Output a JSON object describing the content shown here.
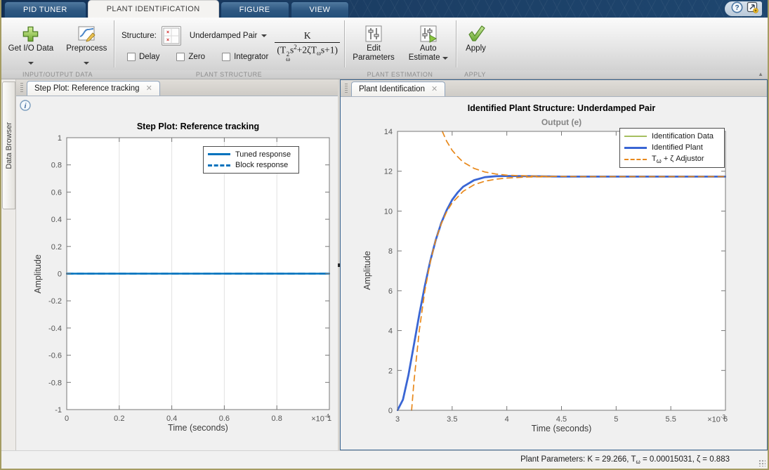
{
  "tabs": [
    {
      "label": "PID TUNER",
      "active": false
    },
    {
      "label": "PLANT IDENTIFICATION",
      "active": true
    },
    {
      "label": "FIGURE",
      "active": false
    },
    {
      "label": "VIEW",
      "active": false
    }
  ],
  "ribbon": {
    "get_io_data": "Get I/O Data",
    "preprocess": "Preprocess",
    "structure_label": "Structure:",
    "structure_value": "Underdamped Pair",
    "checkboxes": {
      "delay": "Delay",
      "zero": "Zero",
      "integrator": "Integrator"
    },
    "formula": {
      "num": "K",
      "d1": "(T",
      "d1_sup": "2",
      "d1_sub": "ω",
      "d2": "s",
      "d2_sup": "2",
      "d3": "+2ζT",
      "d3_sub": "ω",
      "d4": "s+1)"
    },
    "edit_parameters_1": "Edit",
    "edit_parameters_2": "Parameters",
    "auto_estimate_1": "Auto",
    "auto_estimate_2": "Estimate",
    "apply": "Apply",
    "sections": {
      "io": "INPUT/OUTPUT DATA",
      "structure": "PLANT STRUCTURE",
      "estimation": "PLANT ESTIMATION",
      "apply": "APPLY"
    }
  },
  "data_browser": {
    "title": "Data Browser"
  },
  "left_panel": {
    "tab": "Step Plot: Reference tracking"
  },
  "right_panel": {
    "tab": "Plant Identification"
  },
  "status": {
    "prefix": "Plant Parameters: K = 29.266, T",
    "sub": "ω",
    "suffix": " = 0.00015031, ζ = 0.883"
  },
  "chart_data": [
    {
      "type": "line",
      "title": "Step Plot: Reference tracking",
      "xlabel": "Time (seconds)",
      "ylabel": "Amplitude",
      "exponent": {
        "base": "×10",
        "sup": "-4"
      },
      "xlim": [
        0,
        1
      ],
      "ylim": [
        -1,
        1
      ],
      "x_scale_note": "x values in units of 1e-4 seconds",
      "xticks": [
        [
          0,
          "0"
        ],
        [
          0.2,
          "0.2"
        ],
        [
          0.4,
          "0.4"
        ],
        [
          0.6,
          "0.6"
        ],
        [
          0.8,
          "0.8"
        ],
        [
          1,
          "1"
        ]
      ],
      "yticks": [
        [
          -1,
          "-1"
        ],
        [
          -0.8,
          "-0.8"
        ],
        [
          -0.6,
          "-0.6"
        ],
        [
          -0.4,
          "-0.4"
        ],
        [
          -0.2,
          "-0.2"
        ],
        [
          0,
          "0"
        ],
        [
          0.2,
          "0.2"
        ],
        [
          0.4,
          "0.4"
        ],
        [
          0.6,
          "0.6"
        ],
        [
          0.8,
          "0.8"
        ],
        [
          1,
          "1"
        ]
      ],
      "grid_vertical": true,
      "legend_position": "upper-right",
      "legend_rows": [
        {
          "label": "Tuned response"
        },
        {
          "label": "Block response"
        }
      ],
      "series": [
        {
          "id": "block-response-line",
          "name": "Block response",
          "color": "#0072bd",
          "width": 2.5,
          "dash": "9 6",
          "points": [
            [
              0,
              0
            ],
            [
              1,
              0
            ]
          ]
        },
        {
          "id": "tuned-response-line",
          "name": "Tuned response",
          "color": "#0072bd",
          "width": 2.5,
          "dash": null,
          "points": [
            [
              0,
              0
            ],
            [
              1,
              0
            ]
          ]
        }
      ]
    },
    {
      "type": "line",
      "title": "Identified Plant Structure: Underdamped Pair",
      "subtitle": "Output (e)",
      "xlabel": "Time (seconds)",
      "ylabel": "Amplitude",
      "exponent": {
        "base": "×10",
        "sup": "-3"
      },
      "xlim": [
        3,
        6
      ],
      "ylim": [
        0,
        14
      ],
      "x_scale_note": "x values in units of 1e-3 seconds",
      "xticks": [
        [
          3,
          "3"
        ],
        [
          3.5,
          "3.5"
        ],
        [
          4,
          "4"
        ],
        [
          4.5,
          "4.5"
        ],
        [
          5,
          "5"
        ],
        [
          5.5,
          "5.5"
        ],
        [
          6,
          "6"
        ]
      ],
      "yticks": [
        [
          0,
          "0"
        ],
        [
          2,
          "2"
        ],
        [
          4,
          "4"
        ],
        [
          6,
          "6"
        ],
        [
          8,
          "8"
        ],
        [
          10,
          "10"
        ],
        [
          12,
          "12"
        ],
        [
          14,
          "14"
        ]
      ],
      "grid_vertical": false,
      "legend_position": "upper-right",
      "legend_rows": [
        {
          "label": "Identification Data"
        },
        {
          "label": "Identified Plant"
        },
        {
          "pre": "T",
          "sub": "ω",
          "post": " + ζ Adjustor"
        }
      ],
      "steady_state_value": 11.73,
      "series": [
        {
          "id": "identification-data-line",
          "name": "Identification Data",
          "color": "#a6bf60",
          "width": 2,
          "dash": null,
          "points": [
            [
              3.0,
              0
            ],
            [
              3.05,
              0.54
            ],
            [
              3.1,
              1.77
            ],
            [
              3.15,
              3.27
            ],
            [
              3.2,
              4.82
            ],
            [
              3.25,
              6.24
            ],
            [
              3.3,
              7.5
            ],
            [
              3.35,
              8.55
            ],
            [
              3.4,
              9.4
            ],
            [
              3.45,
              10.05
            ],
            [
              3.5,
              10.56
            ],
            [
              3.55,
              10.93
            ],
            [
              3.6,
              11.22
            ],
            [
              3.7,
              11.55
            ],
            [
              3.8,
              11.7
            ],
            [
              3.9,
              11.75
            ],
            [
              4.0,
              11.76
            ],
            [
              4.2,
              11.75
            ],
            [
              4.5,
              11.73
            ],
            [
              6.0,
              11.73
            ]
          ]
        },
        {
          "id": "identified-plant-line",
          "name": "Identified Plant",
          "color": "#3a66d4",
          "width": 2.8,
          "dash": null,
          "points": [
            [
              3.0,
              0
            ],
            [
              3.05,
              0.54
            ],
            [
              3.1,
              1.77
            ],
            [
              3.15,
              3.27
            ],
            [
              3.2,
              4.82
            ],
            [
              3.25,
              6.24
            ],
            [
              3.3,
              7.5
            ],
            [
              3.35,
              8.55
            ],
            [
              3.4,
              9.4
            ],
            [
              3.45,
              10.05
            ],
            [
              3.5,
              10.56
            ],
            [
              3.55,
              10.93
            ],
            [
              3.6,
              11.22
            ],
            [
              3.7,
              11.55
            ],
            [
              3.8,
              11.7
            ],
            [
              3.9,
              11.75
            ],
            [
              4.0,
              11.76
            ],
            [
              4.2,
              11.75
            ],
            [
              4.5,
              11.73
            ],
            [
              6.0,
              11.73
            ]
          ]
        },
        {
          "id": "adjustor-lower-envelope",
          "name": "Tω + ζ Adjustor (lower envelope)",
          "color": "#e8891c",
          "width": 1.7,
          "dash": "8 6",
          "points": [
            [
              3.129,
              0
            ],
            [
              3.15,
              1.39
            ],
            [
              3.2,
              4.02
            ],
            [
              3.25,
              5.98
            ],
            [
              3.3,
              7.45
            ],
            [
              3.35,
              8.55
            ],
            [
              3.4,
              9.36
            ],
            [
              3.45,
              9.97
            ],
            [
              3.5,
              10.41
            ],
            [
              3.6,
              10.99
            ],
            [
              3.7,
              11.32
            ],
            [
              3.8,
              11.5
            ],
            [
              3.9,
              11.6
            ],
            [
              4.0,
              11.66
            ],
            [
              4.2,
              11.71
            ],
            [
              4.4,
              11.72
            ]
          ]
        },
        {
          "id": "adjustor-upper-envelope",
          "name": "Tω + ζ Adjustor (upper envelope)",
          "color": "#e8891c",
          "width": 1.7,
          "dash": "8 6",
          "points": [
            [
              3.41,
              14.0
            ],
            [
              3.45,
              13.5
            ],
            [
              3.5,
              13.05
            ],
            [
              3.55,
              12.73
            ],
            [
              3.6,
              12.46
            ],
            [
              3.7,
              12.14
            ],
            [
              3.8,
              11.96
            ],
            [
              3.9,
              11.86
            ],
            [
              4.0,
              11.8
            ],
            [
              4.2,
              11.76
            ],
            [
              4.4,
              11.74
            ],
            [
              4.7,
              11.73
            ],
            [
              6.0,
              11.73
            ]
          ]
        }
      ]
    }
  ]
}
